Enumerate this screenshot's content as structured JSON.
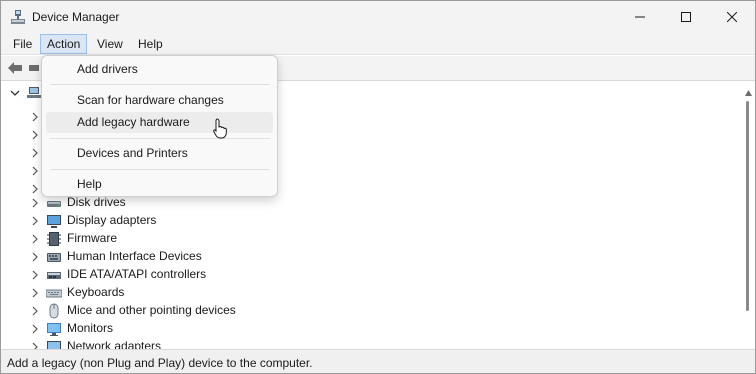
{
  "window": {
    "title": "Device Manager"
  },
  "menubar": {
    "items": [
      "File",
      "Action",
      "View",
      "Help"
    ],
    "active": "Action"
  },
  "action_menu": {
    "items": [
      {
        "label": "Add drivers"
      },
      {
        "label": "Scan for hardware changes"
      },
      {
        "label": "Add legacy hardware",
        "hovered": true
      },
      {
        "label": "Devices and Printers"
      },
      {
        "label": "Help"
      }
    ]
  },
  "tree": {
    "categories": [
      {
        "label": "Disk drives",
        "icon": "disk-drive-icon"
      },
      {
        "label": "Display adapters",
        "icon": "display-adapter-icon"
      },
      {
        "label": "Firmware",
        "icon": "firmware-icon"
      },
      {
        "label": "Human Interface Devices",
        "icon": "hid-icon"
      },
      {
        "label": "IDE ATA/ATAPI controllers",
        "icon": "ide-controller-icon"
      },
      {
        "label": "Keyboards",
        "icon": "keyboard-icon"
      },
      {
        "label": "Mice and other pointing devices",
        "icon": "mouse-icon"
      },
      {
        "label": "Monitors",
        "icon": "monitor-icon"
      },
      {
        "label": "Network adapters",
        "icon": "network-adapter-icon"
      }
    ]
  },
  "statusbar": {
    "text": "Add a legacy (non Plug and Play) device to the computer."
  },
  "colors": {
    "menu_active_bg": "#dbe6f4",
    "menu_active_border": "#9cbfe6",
    "hover_bg": "#ececec",
    "chrome_bg": "#f3f3f3"
  }
}
